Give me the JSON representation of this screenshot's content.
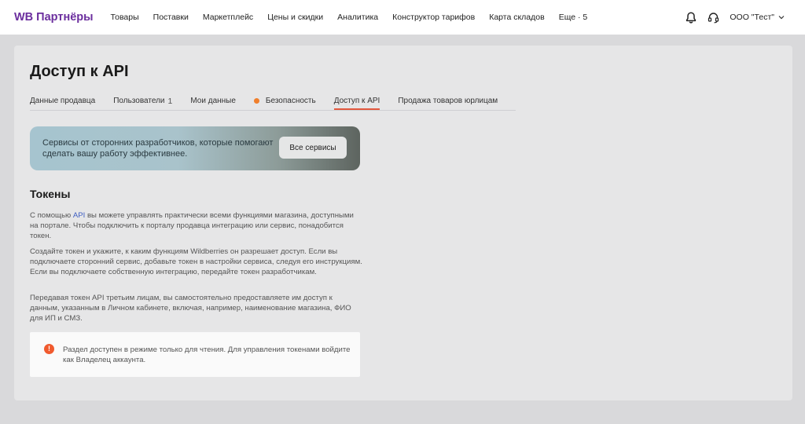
{
  "header": {
    "logo": "WB Партнёры",
    "nav": [
      "Товары",
      "Поставки",
      "Маркетплейс",
      "Цены и скидки",
      "Аналитика",
      "Конструктор тарифов",
      "Карта складов",
      "Еще · 5"
    ],
    "account": "ООО \"Тест\"",
    "icons": [
      "bell-icon",
      "headset-icon",
      "chevron-down-icon"
    ]
  },
  "page": {
    "title": "Доступ к API"
  },
  "tabs": [
    {
      "label": "Данные продавца"
    },
    {
      "label": "Пользователи",
      "count": "1"
    },
    {
      "label": "Мои данные"
    },
    {
      "label": "Безопасность",
      "dot_color": "#f07f2c"
    },
    {
      "label": "Доступ к API",
      "active": true
    },
    {
      "label": "Продажа товаров юрлицам"
    }
  ],
  "banner": {
    "text": "Сервисы от сторонних разработчиков, которые помогают сделать вашу работу эффективнее.",
    "button": "Все сервисы"
  },
  "tokens": {
    "title": "Токены",
    "p1_before": "С помощью ",
    "p1_link": "API",
    "p1_after": " вы можете управлять практически всеми функциями магазина, доступными на портале. Чтобы подключить к порталу продавца интеграцию или сервис, понадобится токен.",
    "p2": "Создайте токен и укажите, к каким функциям Wildberries он разрешает доступ. Если вы подключаете сторонний сервис, добавьте токен в настройки сервиса, следуя его инструкциям. Если вы подключаете собственную интеграцию, передайте токен разработчикам.",
    "p3": "Передавая токен API третьим лицам, вы самостоятельно предоставляете им доступ к данным, указанным в Личном кабинете, включая, например, наименование магазина, ФИО для ИП и СМЗ."
  },
  "alert": {
    "icon_symbol": "!",
    "text": "Раздел доступен в режиме только для чтения. Для управления токенами войдите как Владелец аккаунта.",
    "color": "#f05a2e"
  },
  "colors": {
    "brand": "#6b2e9e",
    "active_tab": "#e2583e",
    "link": "#3f5fc2"
  }
}
